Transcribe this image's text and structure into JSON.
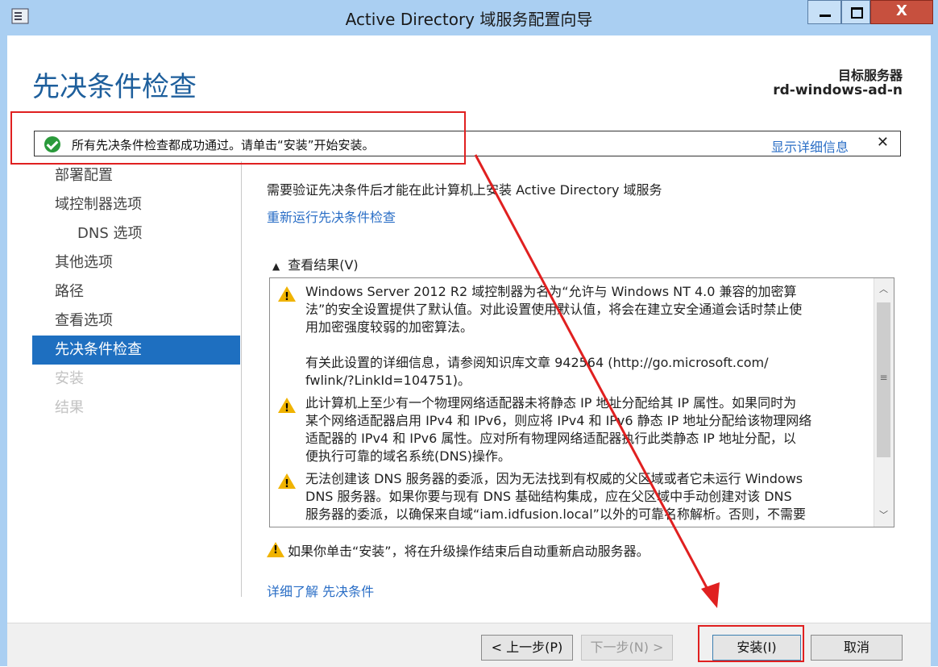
{
  "window": {
    "title": "Active Directory 域服务配置向导"
  },
  "page": {
    "title": "先决条件检查",
    "target_label": "目标服务器",
    "target_name": "rd-windows-ad-n"
  },
  "status_bar": {
    "message": "所有先决条件检查都成功通过。请单击“安装”开始安装。",
    "details_link": "显示详细信息",
    "close": "✕"
  },
  "nav": {
    "items": [
      {
        "label": "部署配置",
        "state": "normal"
      },
      {
        "label": "域控制器选项",
        "state": "normal"
      },
      {
        "label": "DNS 选项",
        "state": "sub"
      },
      {
        "label": "其他选项",
        "state": "normal"
      },
      {
        "label": "路径",
        "state": "normal"
      },
      {
        "label": "查看选项",
        "state": "normal"
      },
      {
        "label": "先决条件检查",
        "state": "active"
      },
      {
        "label": "安装",
        "state": "disabled"
      },
      {
        "label": "结果",
        "state": "disabled"
      }
    ]
  },
  "main": {
    "description": "需要验证先决条件后才能在此计算机上安装 Active Directory 域服务",
    "rerun_link": "重新运行先决条件检查",
    "results_header": "查看结果(V)",
    "results": [
      {
        "lines": [
          "Windows Server 2012 R2 域控制器为名为“允许与 Windows NT 4.0 兼容的加密算",
          "法”的安全设置提供了默认值。对此设置使用默认值，将会在建立安全通道会话时禁止使",
          "用加密强度较弱的加密算法。"
        ],
        "extra": [
          "有关此设置的详细信息，请参阅知识库文章 942564 (http://go.microsoft.com/",
          "fwlink/?LinkId=104751)。"
        ]
      },
      {
        "lines": [
          "此计算机上至少有一个物理网络适配器未将静态 IP 地址分配给其 IP 属性。如果同时为",
          "某个网络适配器启用 IPv4 和 IPv6，则应将 IPv4 和 IPv6 静态 IP 地址分配给该物理网络",
          "适配器的 IPv4 和 IPv6 属性。应对所有物理网络适配器执行此类静态 IP 地址分配，以",
          "便执行可靠的域名系统(DNS)操作。"
        ]
      },
      {
        "lines": [
          "无法创建该 DNS 服务器的委派，因为无法找到有权威的父区域或者它未运行 Windows",
          "DNS 服务器。如果你要与现有 DNS 基础结构集成，应在父区域中手动创建对该 DNS",
          "服务器的委派，以确保来自域“iam.idfusion.local”以外的可靠名称解析。否则，不需要"
        ]
      }
    ],
    "reboot_note": "如果你单击“安装”，将在升级操作结束后自动重新启动服务器。",
    "learn_more": "详细了解 先决条件"
  },
  "footer": {
    "prev": "< 上一步(P)",
    "next": "下一步(N) >",
    "install": "安装(I)",
    "cancel": "取消"
  },
  "colors": {
    "accent": "#1e6fc0",
    "title_blue": "#1e5f9c",
    "link": "#2a6ec6",
    "annotation_red": "#e02020",
    "success_green": "#2a9a3b",
    "warning_yellow": "#f0b300"
  },
  "icons": {
    "app": "server-manager-icon",
    "status": "check-circle-icon",
    "warning": "warning-icon"
  }
}
